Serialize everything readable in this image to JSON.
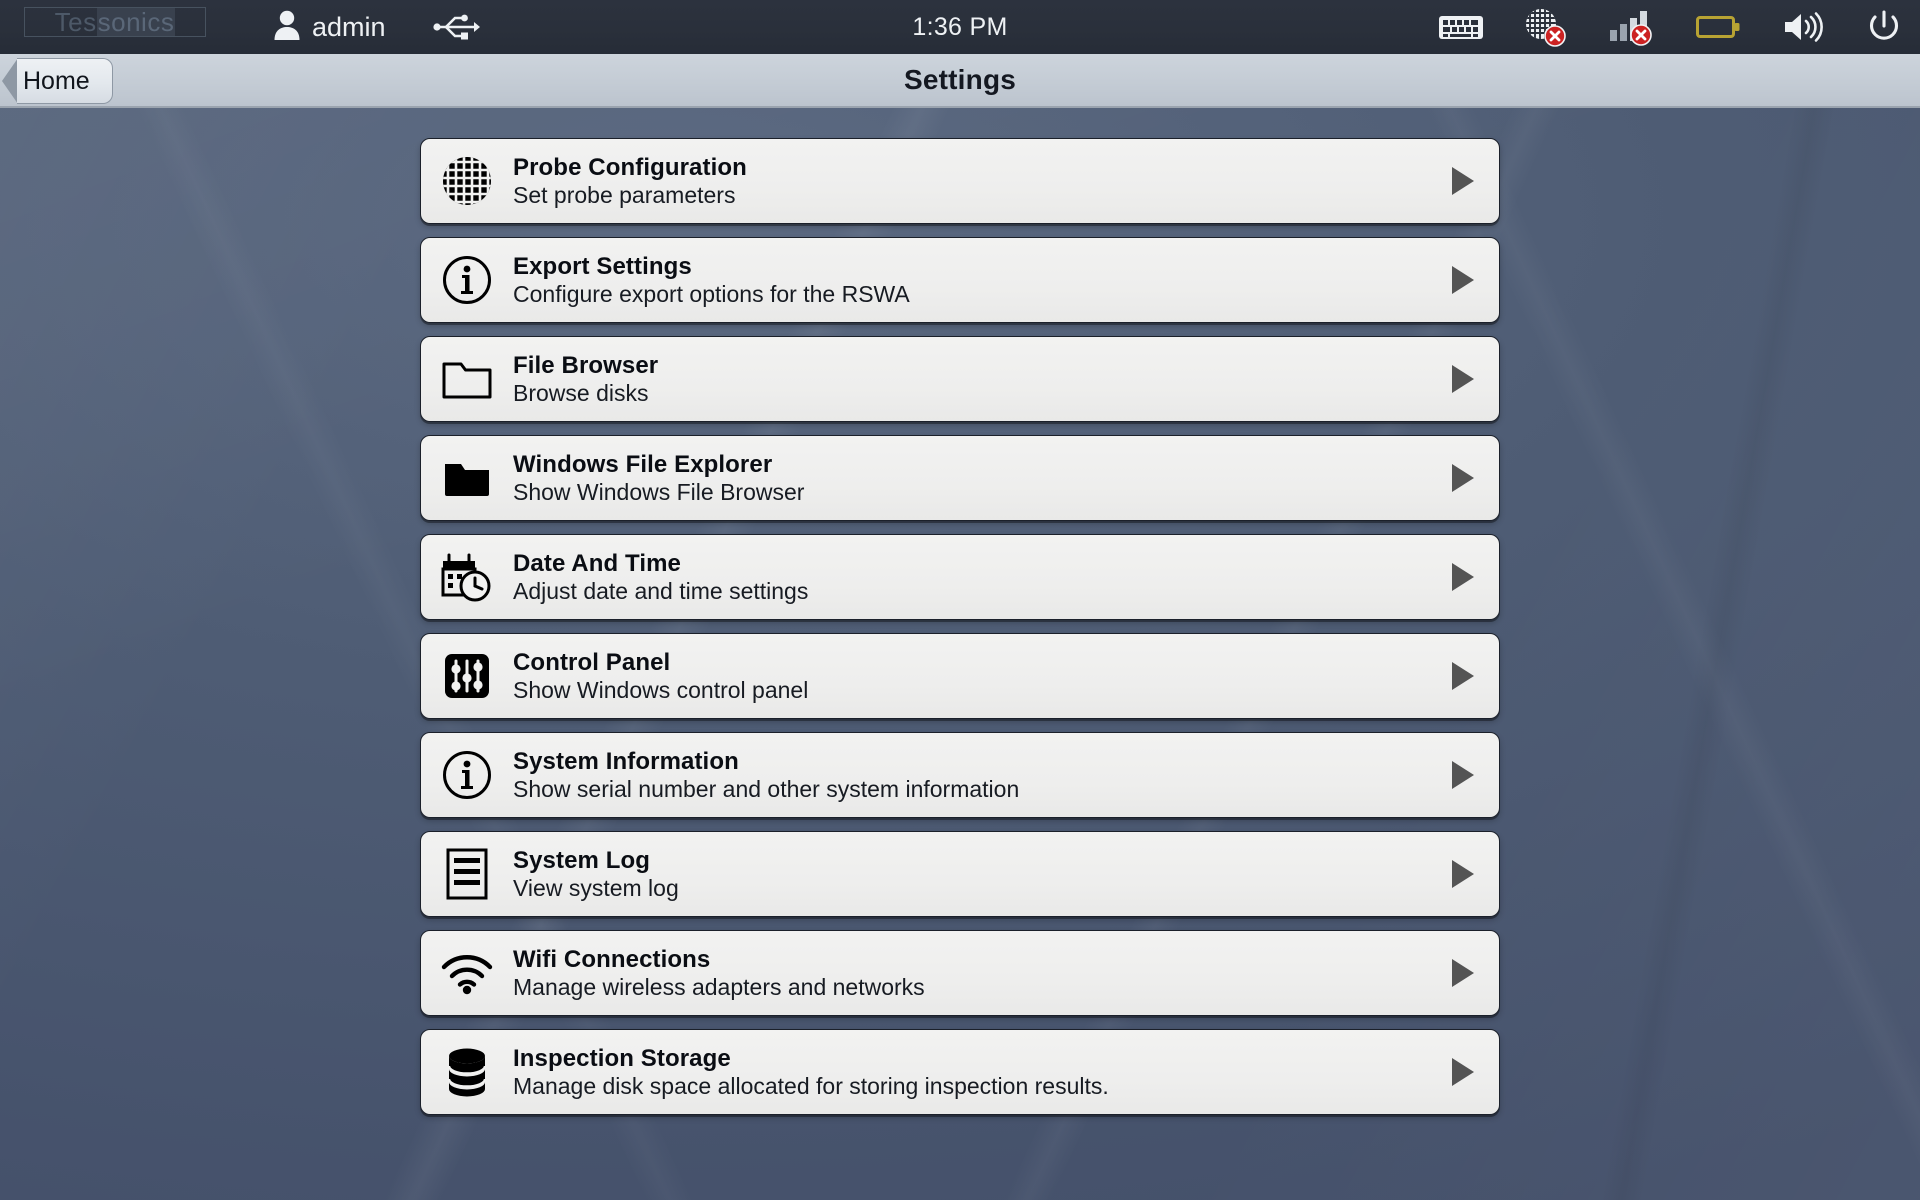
{
  "topbar": {
    "logo_part1": "Tes",
    "logo_part2": "sonics",
    "user": "admin",
    "usb_icon": "usb-icon",
    "clock": "1:36 PM",
    "tray": [
      {
        "name": "keyboard-icon",
        "label": "keyboard"
      },
      {
        "name": "network-disconnected-icon",
        "label": "network disconnected"
      },
      {
        "name": "cellular-signal-disconnected-icon",
        "label": "cellular disconnected"
      },
      {
        "name": "battery-icon",
        "label": "battery empty"
      },
      {
        "name": "volume-icon",
        "label": "volume"
      },
      {
        "name": "power-icon",
        "label": "power"
      }
    ]
  },
  "titlebar": {
    "home_label": "Home",
    "title": "Settings"
  },
  "colors": {
    "desktop": "#4f5d75",
    "topbar": "#2a303b",
    "titlebar": "#c4ccd5",
    "card": "#eeeeed",
    "card_border": "#1b202a",
    "arrow": "#545454",
    "battery_outline": "#b8a333",
    "error_badge": "#cc2222"
  },
  "settings_items": [
    {
      "icon": "globe-mesh-icon",
      "title": "Probe Configuration",
      "subtitle": "Set probe parameters"
    },
    {
      "icon": "info-circle-icon",
      "title": "Export Settings",
      "subtitle": "Configure export options for the RSWA"
    },
    {
      "icon": "folder-outline-icon",
      "title": "File Browser",
      "subtitle": "Browse disks"
    },
    {
      "icon": "folder-filled-icon",
      "title": "Windows File Explorer",
      "subtitle": "Show Windows File Browser"
    },
    {
      "icon": "calendar-clock-icon",
      "title": "Date And Time",
      "subtitle": "Adjust date and time settings"
    },
    {
      "icon": "sliders-icon",
      "title": "Control Panel",
      "subtitle": "Show Windows control panel"
    },
    {
      "icon": "info-circle-icon",
      "title": "System Information",
      "subtitle": "Show serial number and other system information"
    },
    {
      "icon": "document-lines-icon",
      "title": "System Log",
      "subtitle": "View system log"
    },
    {
      "icon": "wifi-icon",
      "title": "Wifi Connections",
      "subtitle": "Manage wireless adapters and networks"
    },
    {
      "icon": "database-icon",
      "title": "Inspection Storage",
      "subtitle": "Manage disk space allocated for storing inspection results."
    }
  ]
}
